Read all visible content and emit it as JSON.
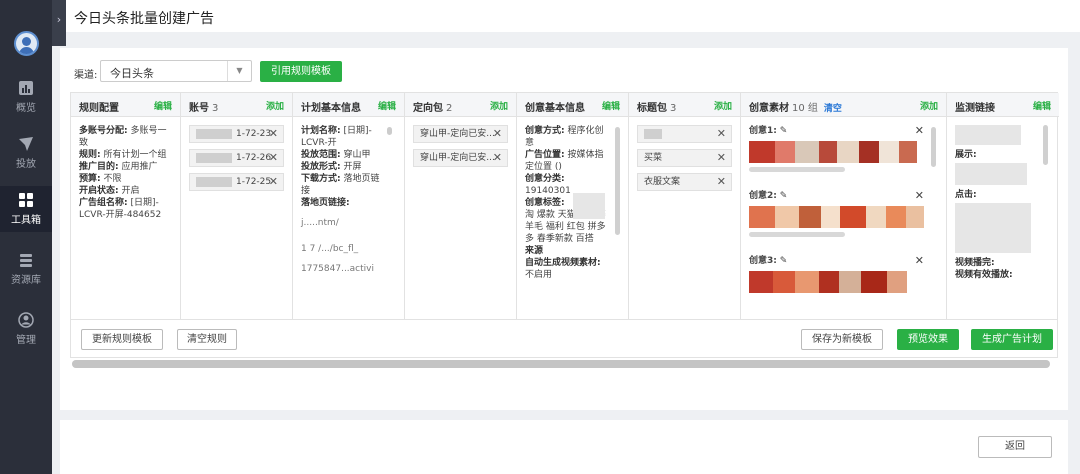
{
  "sidebar": {
    "items": [
      {
        "label": "概览",
        "icon": "chart-icon"
      },
      {
        "label": "投放",
        "icon": "send-icon"
      },
      {
        "label": "工具箱",
        "icon": "toolbox-icon",
        "active": true
      },
      {
        "label": "资源库",
        "icon": "database-icon"
      },
      {
        "label": "管理",
        "icon": "user-icon"
      }
    ]
  },
  "header": {
    "title": "今日头条批量创建广告"
  },
  "channel": {
    "label": "渠道:",
    "value": "今日头条"
  },
  "buttons": {
    "cite_template": "引用规则模板",
    "update_template": "更新规则模板",
    "clear_rules": "清空规则",
    "save_new_template": "保存为新模板",
    "preview": "预览效果",
    "generate_plan": "生成广告计划",
    "back": "返回"
  },
  "columns": {
    "rules": {
      "title": "规则配置",
      "action": "编辑",
      "lines": [
        {
          "k": "多账号分配:",
          "v": "多账号一致"
        },
        {
          "k": "规则:",
          "v": "所有计划一个组"
        },
        {
          "k": "推广目的:",
          "v": "应用推广"
        },
        {
          "k": "预算:",
          "v": "不限"
        },
        {
          "k": "开启状态:",
          "v": "开启"
        },
        {
          "k": "广告组名称:",
          "v": "[日期]-LCVR-开屏-484652"
        }
      ]
    },
    "accounts": {
      "title": "账号",
      "count": "3",
      "action": "添加",
      "items": [
        "1-72-23",
        "1-72-26",
        "1-72-25"
      ]
    },
    "plan": {
      "title": "计划基本信息",
      "action": "编辑",
      "lines": [
        {
          "k": "计划名称:",
          "v": "[日期]-LCVR-开"
        },
        {
          "k": "投放范围:",
          "v": "穿山甲"
        },
        {
          "k": "投放形式:",
          "v": "开屏"
        },
        {
          "k": "下载方式:",
          "v": "落地页链接"
        },
        {
          "k": "落地页链接:",
          "v": ""
        }
      ],
      "fragments": [
        "j.....ntm/",
        "1 7 /.../bc_fl_",
        "1775847...activi"
      ]
    },
    "targeting": {
      "title": "定向包",
      "count": "2",
      "action": "添加",
      "items": [
        "穿山甲-定向已安...",
        "穿山甲-定向已安..."
      ]
    },
    "creative": {
      "title": "创意基本信息",
      "action": "编辑",
      "lines": [
        {
          "k": "创意方式:",
          "v": "程序化创意"
        },
        {
          "k": "广告位置:",
          "v": "按媒体指定位置 ()"
        },
        {
          "k": "创意分类:",
          "v": "19140301"
        },
        {
          "k": "创意标签:",
          "v": ""
        },
        {
          "k": "",
          "v": "淘 爆款 天猫同款 薅羊毛 福利 红包 拼多多 春季新款 百搭"
        },
        {
          "k": "来源",
          "v": ""
        },
        {
          "k": "自动生成视频素材:",
          "v": "不启用"
        }
      ]
    },
    "titles": {
      "title": "标题包",
      "count": "3",
      "action": "添加",
      "items": [
        "",
        "买菜",
        "衣服文案"
      ]
    },
    "materials": {
      "title": "创意素材",
      "count": "10 组",
      "action": "添加",
      "clear": "清空",
      "items": [
        "创意1:",
        "创意2:",
        "创意3:"
      ]
    },
    "monitor": {
      "title": "监测链接",
      "action": "编辑",
      "lines": [
        "展示:",
        "点击:",
        "视频播完:",
        "视频有效播放:"
      ]
    }
  }
}
